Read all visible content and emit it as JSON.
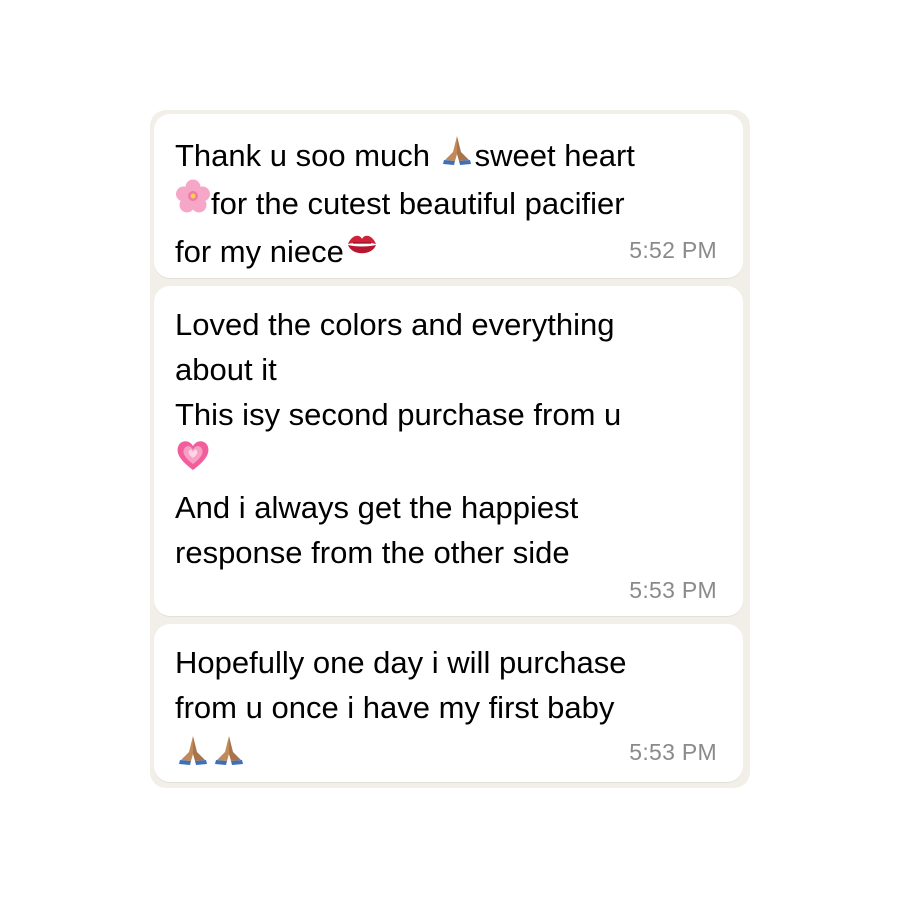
{
  "chat": {
    "messages": [
      {
        "lines": [
          {
            "parts": [
              "Thank u soo much ",
              "🙏🏽",
              "sweet heart"
            ]
          },
          {
            "parts": [
              "🌸",
              "for the cutest beautiful pacifier"
            ]
          },
          {
            "parts": [
              "for my niece",
              "💋"
            ]
          }
        ],
        "time": "5:52 PM"
      },
      {
        "lines": [
          {
            "parts": [
              "Loved the colors and everything"
            ]
          },
          {
            "parts": [
              "about it"
            ]
          },
          {
            "parts": [
              "This isy second purchase from u"
            ]
          },
          {
            "parts": [
              "💗"
            ]
          },
          {
            "parts": [
              "And i always get the happiest"
            ]
          },
          {
            "parts": [
              "response from the other side"
            ]
          }
        ],
        "time": "5:53 PM"
      },
      {
        "lines": [
          {
            "parts": [
              "Hopefully one day i will purchase"
            ]
          },
          {
            "parts": [
              "from u once i have my first baby"
            ]
          },
          {
            "parts": [
              "🙏🏽",
              "🙏🏽"
            ]
          }
        ],
        "time": "5:53 PM"
      }
    ]
  },
  "icons": {
    "praying-hands": "folded-hands-icon",
    "blossom": "cherry-blossom-icon",
    "kiss": "kiss-mark-icon",
    "heart": "growing-heart-icon"
  },
  "colors": {
    "chat_background": "#f2efe8",
    "bubble": "#ffffff",
    "text": "#000000",
    "timestamp": "#8a8a8a"
  }
}
